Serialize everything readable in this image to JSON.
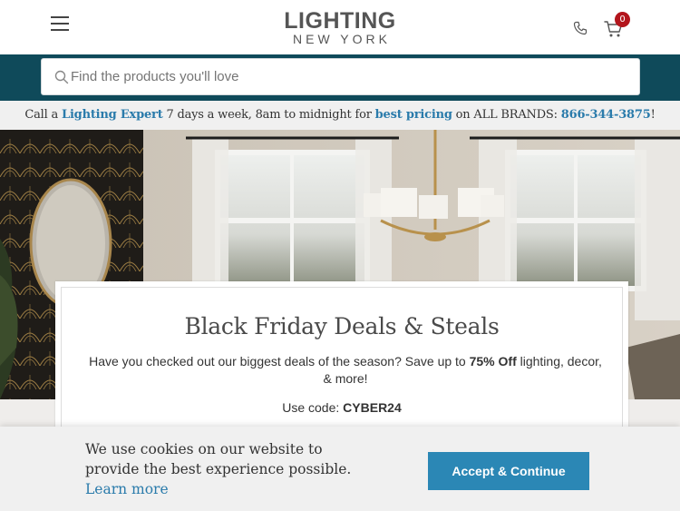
{
  "header": {
    "logo_top": "LIGHTING",
    "logo_bottom": "NEW YORK",
    "cart_count": "0"
  },
  "search": {
    "placeholder": "Find the products you'll love",
    "value": ""
  },
  "promo": {
    "pre": "Call a ",
    "expert_link": "Lighting Expert",
    "mid": " 7 days a week, 8am to midnight for ",
    "pricing_link": "best pricing",
    "post": " on ALL BRANDS: ",
    "phone_link": "866-344-3875",
    "end": "!"
  },
  "deal_card": {
    "title": "Black Friday Deals & Steals",
    "text_pre": "Have you checked out our biggest deals of the season? Save up to ",
    "text_bold": "75% Off",
    "text_post": " lighting, decor, & more!",
    "code_label": "Use code: ",
    "code_value": "CYBER24"
  },
  "cookie": {
    "message": "We use cookies on our website to provide the best experience possible.",
    "learn_more": "Learn more",
    "accept_label": "Accept & Continue"
  },
  "icons": {
    "menu": "hamburger-menu-icon",
    "phone": "phone-icon",
    "cart": "cart-icon",
    "search": "search-icon"
  },
  "colors": {
    "search_band": "#0f4a5a",
    "link": "#2a7bab",
    "accept_button": "#2b87b5",
    "cart_badge": "#b3151c"
  }
}
